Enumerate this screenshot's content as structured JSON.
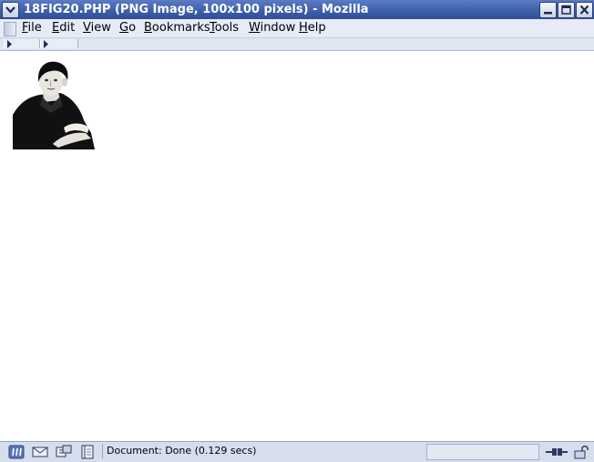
{
  "window": {
    "title": "18FIG20.PHP (PNG Image, 100x100 pixels) - Mozilla",
    "buttons": [
      "minimize",
      "maximize",
      "close"
    ]
  },
  "menubar": {
    "items": [
      {
        "label": "File",
        "mnemonic": "F"
      },
      {
        "label": "Edit",
        "mnemonic": "E"
      },
      {
        "label": "View",
        "mnemonic": "V"
      },
      {
        "label": "Go",
        "mnemonic": "G"
      },
      {
        "label": "Bookmarks",
        "mnemonic": "B"
      },
      {
        "label": "Tools",
        "mnemonic": "T"
      },
      {
        "label": "Window",
        "mnemonic": "W"
      },
      {
        "label": "Help",
        "mnemonic": "H"
      }
    ]
  },
  "content": {
    "image": {
      "alt": "man portrait",
      "kind": "black-and-white photo"
    }
  },
  "statusbar": {
    "text": "Document: Done (0.129 secs)",
    "icons": [
      "mozilla-icon",
      "mail-icon",
      "composer-icon",
      "address-book-icon",
      "connection-icon",
      "security-lock-icon"
    ]
  },
  "colors": {
    "titlebar": "#3c5da8",
    "chrome": "#e6ebf5",
    "statusbar": "#d6dded"
  }
}
